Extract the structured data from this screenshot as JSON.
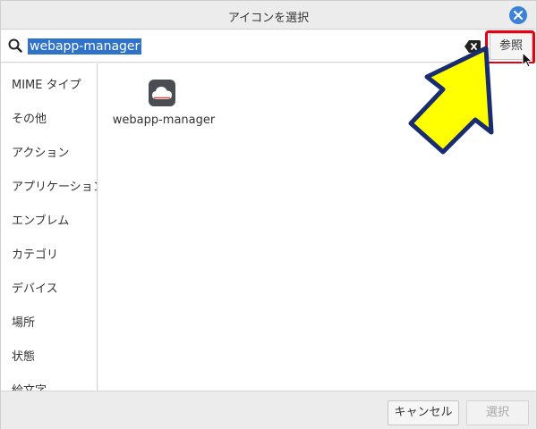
{
  "dialog": {
    "title": "アイコンを選択"
  },
  "search": {
    "value": "webapp-manager",
    "placeholder": ""
  },
  "browse_button": {
    "label": "参照"
  },
  "sidebar": {
    "items": [
      {
        "label": "MIME タイプ"
      },
      {
        "label": "その他"
      },
      {
        "label": "アクション"
      },
      {
        "label": "アプリケーション"
      },
      {
        "label": "エンブレム"
      },
      {
        "label": "カテゴリ"
      },
      {
        "label": "デバイス"
      },
      {
        "label": "場所"
      },
      {
        "label": "状態"
      },
      {
        "label": "絵文字"
      }
    ]
  },
  "icons": [
    {
      "label": "webapp-manager",
      "icon": "cloud-icon"
    }
  ],
  "footer": {
    "cancel_label": "キャンセル",
    "select_label": "選択"
  },
  "colors": {
    "selection": "#2f73c9",
    "close_button": "#3d82d8",
    "highlight_border": "#e60012",
    "annotation_arrow": "#ffff00"
  }
}
